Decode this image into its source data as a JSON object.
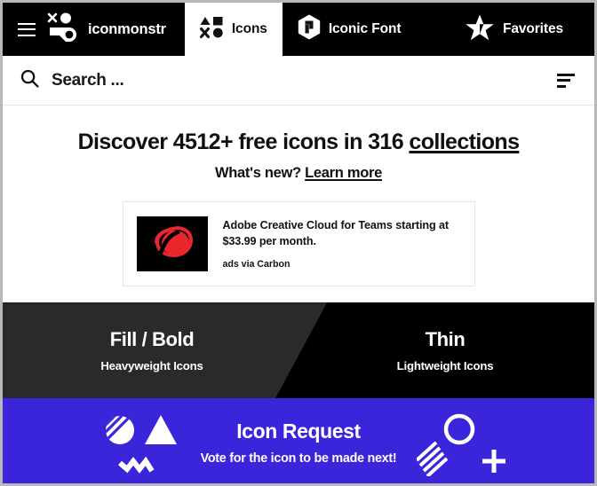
{
  "nav": {
    "menu_icon": "hamburger-icon",
    "brand": {
      "label": "iconmonstr",
      "icon": "iconmonstr-logo-icon"
    },
    "tabs": [
      {
        "label": "Icons",
        "icon": "shapes-grid-icon",
        "active": true
      },
      {
        "label": "Iconic Font",
        "icon": "hexagon-flag-icon",
        "active": false
      },
      {
        "label": "Favorites",
        "icon": "star-icon",
        "active": false
      }
    ]
  },
  "search": {
    "icon": "search-icon",
    "placeholder": "Search ...",
    "value": "",
    "filter_icon": "filter-lines-icon"
  },
  "hero": {
    "title_prefix": "Discover 4512+ free icons in 316 ",
    "title_link": "collections",
    "icon_count": "4512+",
    "collection_count": "316",
    "sub_prefix": "What's new? ",
    "sub_link": "Learn more"
  },
  "ad": {
    "image_alt": "adobe-creative-cloud-logo",
    "headline": "Adobe Creative Cloud for Teams starting at $33.99 per month.",
    "price": "$33.99",
    "via": "ads via Carbon",
    "logo_color": "#e8262b",
    "bg_color": "#000000"
  },
  "split": {
    "left": {
      "title": "Fill / Bold",
      "subtitle": "Heavyweight Icons",
      "bg": "#2a2a2c"
    },
    "right": {
      "title": "Thin",
      "subtitle": "Lightweight Icons",
      "bg": "#000000"
    }
  },
  "request": {
    "title": "Icon Request",
    "subtitle": "Vote for the icon to be made next!",
    "bg_color": "#3a25db",
    "art_left": [
      "striped-circle-icon",
      "triangle-icon",
      "zigzag-icon"
    ],
    "art_right": [
      "circle-outline-icon",
      "diagonal-bars-icon",
      "plus-icon"
    ]
  }
}
